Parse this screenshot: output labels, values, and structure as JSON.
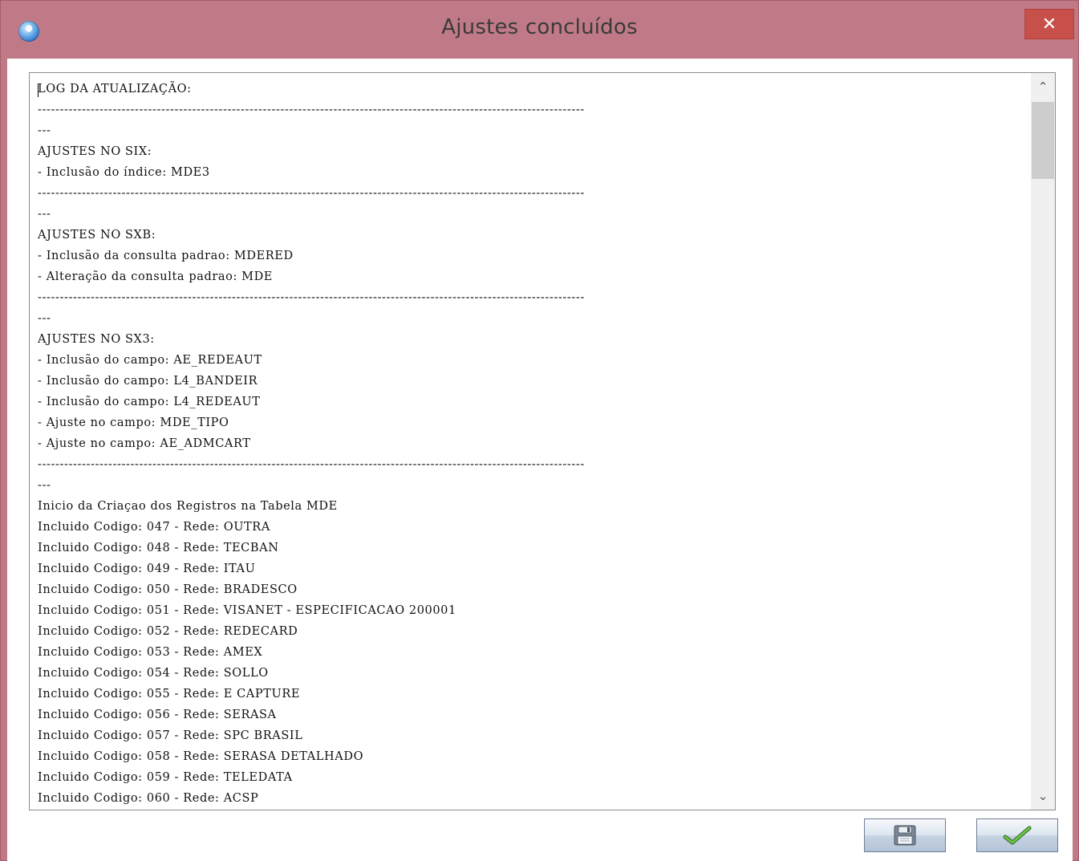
{
  "window": {
    "title": "Ajustes concluídos",
    "close_label": "✕"
  },
  "log": {
    "lines": [
      "LOG DA ATUALIZAÇÃO:",
      "----------------------------------------------------------------------------------------------------------------------------",
      "---",
      "AJUSTES NO SIX:",
      "- Inclusão do índice: MDE3",
      "----------------------------------------------------------------------------------------------------------------------------",
      "---",
      "AJUSTES NO SXB:",
      "- Inclusão da consulta padrao: MDERED",
      "- Alteração da consulta padrao: MDE",
      "----------------------------------------------------------------------------------------------------------------------------",
      "---",
      "AJUSTES NO SX3:",
      "- Inclusão do campo: AE_REDEAUT",
      "- Inclusão do campo: L4_BANDEIR",
      "- Inclusão do campo: L4_REDEAUT",
      "- Ajuste no campo: MDE_TIPO",
      "- Ajuste no campo: AE_ADMCART",
      "----------------------------------------------------------------------------------------------------------------------------",
      "---",
      "Inicio da Criaçao dos Registros na Tabela MDE",
      "Incluido Codigo: 047 - Rede: OUTRA",
      "Incluido Codigo: 048 - Rede: TECBAN",
      "Incluido Codigo: 049 - Rede: ITAU",
      "Incluido Codigo: 050 - Rede: BRADESCO",
      "Incluido Codigo: 051 - Rede: VISANET - ESPECIFICACAO 200001",
      "Incluido Codigo: 052 - Rede: REDECARD",
      "Incluido Codigo: 053 - Rede: AMEX",
      "Incluido Codigo: 054 - Rede: SOLLO",
      "Incluido Codigo: 055 - Rede: E CAPTURE",
      "Incluido Codigo: 056 - Rede: SERASA",
      "Incluido Codigo: 057 - Rede: SPC BRASIL",
      "Incluido Codigo: 058 - Rede: SERASA DETALHADO",
      "Incluido Codigo: 059 - Rede: TELEDATA",
      "Incluido Codigo: 060 - Rede: ACSP"
    ]
  },
  "scrollbar": {
    "up_icon": "chevron-up-icon",
    "down_icon": "chevron-down-icon",
    "up_glyph": "⌃",
    "down_glyph": "⌄"
  },
  "buttons": {
    "save_icon": "floppy-disk-icon",
    "ok_icon": "checkmark-icon"
  },
  "colors": {
    "titlebar": "#c07a87",
    "close_button": "#c7504a",
    "checkmark": "#3f9a2f"
  }
}
